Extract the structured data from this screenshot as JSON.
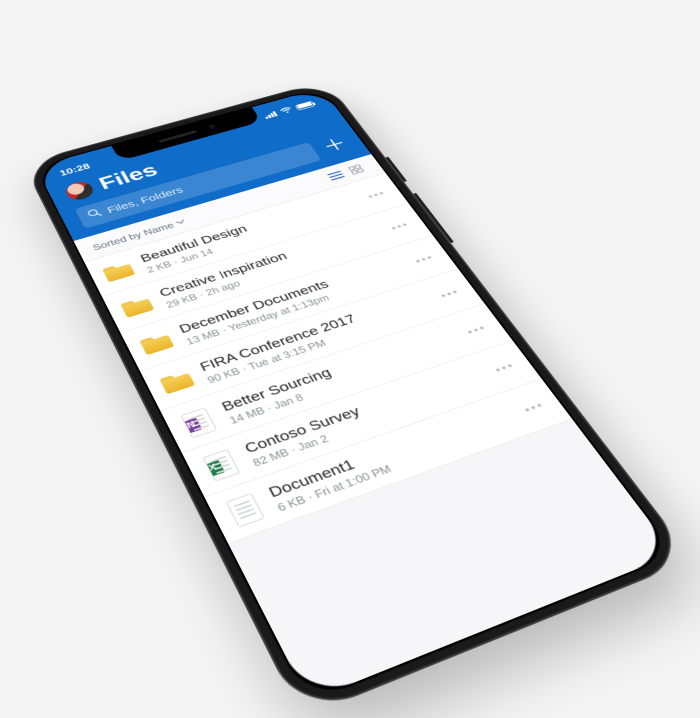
{
  "statusbar": {
    "time": "10:28"
  },
  "header": {
    "title": "Files",
    "search_placeholder": "Files, Folders"
  },
  "sortbar": {
    "label": "Sorted by Name"
  },
  "files": [
    {
      "kind": "folder",
      "name": "Beautiful Design",
      "meta": "2 KB · Jun 14"
    },
    {
      "kind": "folder",
      "name": "Creative Inspiration",
      "meta": "29 KB · 2h ago"
    },
    {
      "kind": "folder",
      "name": "December Documents",
      "meta": "13 MB · Yesterday at 1:13pm"
    },
    {
      "kind": "folder",
      "name": "FIRA Conference 2017",
      "meta": "90 KB · Tue at 3:15 PM"
    },
    {
      "kind": "onenote",
      "name": "Better Sourcing",
      "meta": "14 MB · Jan 8"
    },
    {
      "kind": "excel",
      "name": "Contoso Survey",
      "meta": "82 MB · Jan 2"
    },
    {
      "kind": "word",
      "name": "Document1",
      "meta": "6 KB · Fri at 1:00 PM"
    }
  ]
}
